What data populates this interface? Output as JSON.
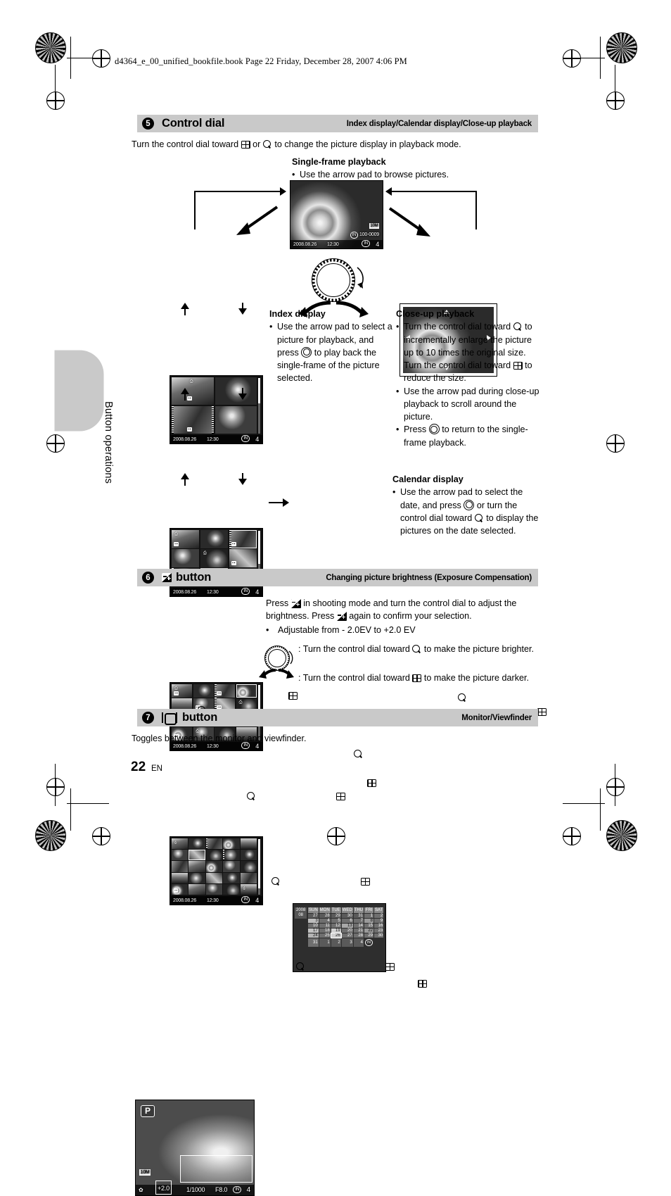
{
  "page": {
    "header_line": "d4364_e_00_unified_bookfile.book  Page 22  Friday, December 28, 2007  4:06 PM",
    "number": "22",
    "language": "EN",
    "side_tab": "Button operations"
  },
  "sections": [
    {
      "number": "5",
      "title": "Control dial",
      "subtitle": "Index display/Calendar display/Close-up playback",
      "intro_pre": "Turn the control dial toward ",
      "intro_mid": " or ",
      "intro_post": " to change the picture display in playback mode."
    },
    {
      "number": "6",
      "title": "button",
      "subtitle": "Changing picture brightness (Exposure Compensation)",
      "para_1a": "Press ",
      "para_1b": " in shooting mode and turn the control dial to adjust the brightness. Press ",
      "para_1c": " again to confirm your selection.",
      "bullet": "Adjustable from - 2.0EV to +2.0 EV",
      "dial_rows": [
        {
          "pre": ": Turn the control dial toward ",
          "post": " to make the picture brighter."
        },
        {
          "pre": ": Turn the control dial toward ",
          "post": " to make the picture darker."
        }
      ]
    },
    {
      "number": "7",
      "title": "button",
      "subtitle": "Monitor/Viewfinder",
      "body": "Toggles between the monitor and viewfinder."
    }
  ],
  "callouts": {
    "single_frame": {
      "title": "Single-frame playback",
      "bullets": [
        "Use the arrow pad to browse pictures."
      ]
    },
    "index": {
      "title": "Index display",
      "bullet_a": "Use the arrow pad to select a picture for playback, and press ",
      "bullet_b": " to play back the single-frame of the picture selected."
    },
    "closeup": {
      "title": "Close-up playback",
      "b1_a": "Turn the control dial toward ",
      "b1_b": " to incrementally enlarge the picture up to 10 times the original size. Turn the control dial toward ",
      "b1_c": " to reduce the size.",
      "b2": "Use the arrow pad during close-up playback to scroll around the picture.",
      "b3_a": "Press ",
      "b3_b": " to return to the single-frame playback."
    },
    "calendar": {
      "title": "Calendar display",
      "b1_a": "Use the arrow pad to select the date, and press ",
      "b1_b": " or turn the control dial toward ",
      "b1_c": " to display the pictures on the date selected."
    }
  },
  "screens": {
    "single_frame": {
      "date": "2008.08.26",
      "time": "12:30",
      "file_no": "100-0009",
      "size_badge": "10M",
      "memory_badge": "IN",
      "frame_no": "4"
    },
    "index_4": {
      "date": "2008.08.26",
      "time": "12:30",
      "memory_badge": "IN",
      "frame_no": "4"
    },
    "index_9": {
      "date": "2008.08.26",
      "time": "12:30",
      "memory_badge": "IN",
      "frame_no": "4"
    },
    "index_16": {
      "date": "2008.08.26",
      "time": "12:30",
      "memory_badge": "IN",
      "frame_no": "4"
    },
    "calendar": {
      "year": "2008",
      "month": "08",
      "weekdays": [
        "SUN",
        "MON",
        "TUE",
        "WED",
        "THU",
        "FRI",
        "SAT"
      ],
      "weeks": [
        [
          "27",
          "28",
          "29",
          "30",
          "31",
          "1",
          "2"
        ],
        [
          "3",
          "4",
          "5",
          "6",
          "7",
          "8",
          "9"
        ],
        [
          "10",
          "11",
          "12",
          "13",
          "14",
          "15",
          "16"
        ],
        [
          "17",
          "18",
          "19",
          "20",
          "21",
          "22",
          "23"
        ],
        [
          "24",
          "25",
          "26",
          "27",
          "28",
          "29",
          "30"
        ],
        [
          "31",
          "1",
          "2",
          "3",
          "4",
          ""
        ]
      ],
      "memory_badge": "IN"
    },
    "exposure": {
      "mode": "P",
      "size_badge": "10M",
      "ev_value": "+2.0",
      "shutter": "1/1000",
      "aperture": "F8.0",
      "memory_badge": "IN",
      "frame_no": "4"
    }
  }
}
